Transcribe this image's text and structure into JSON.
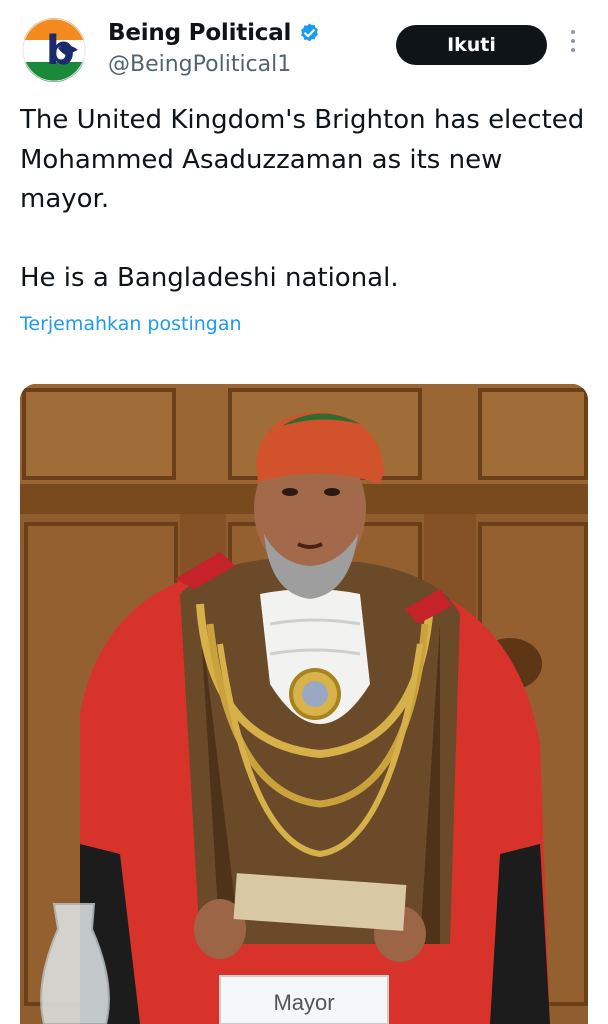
{
  "tweet": {
    "author": {
      "display_name": "Being Political",
      "handle": "@BeingPolitical1",
      "verified": true,
      "avatar_letter": "b"
    },
    "follow_label": "Ikuti",
    "text": {
      "paragraph1": "The United Kingdom's Brighton has elected Mohammed Asaduzzaman as its new mayor.",
      "paragraph2": "He is a Bangladeshi national."
    },
    "translate_label": "Terjemahkan postingan",
    "media": {
      "placard_label": "Mayor"
    }
  },
  "colors": {
    "link": "#1d9bf0",
    "verified_badge": "#1d9bf0",
    "follow_bg": "#0f1419",
    "handle": "#536471"
  },
  "icons": [
    "verified-badge-icon",
    "more-options-icon"
  ]
}
